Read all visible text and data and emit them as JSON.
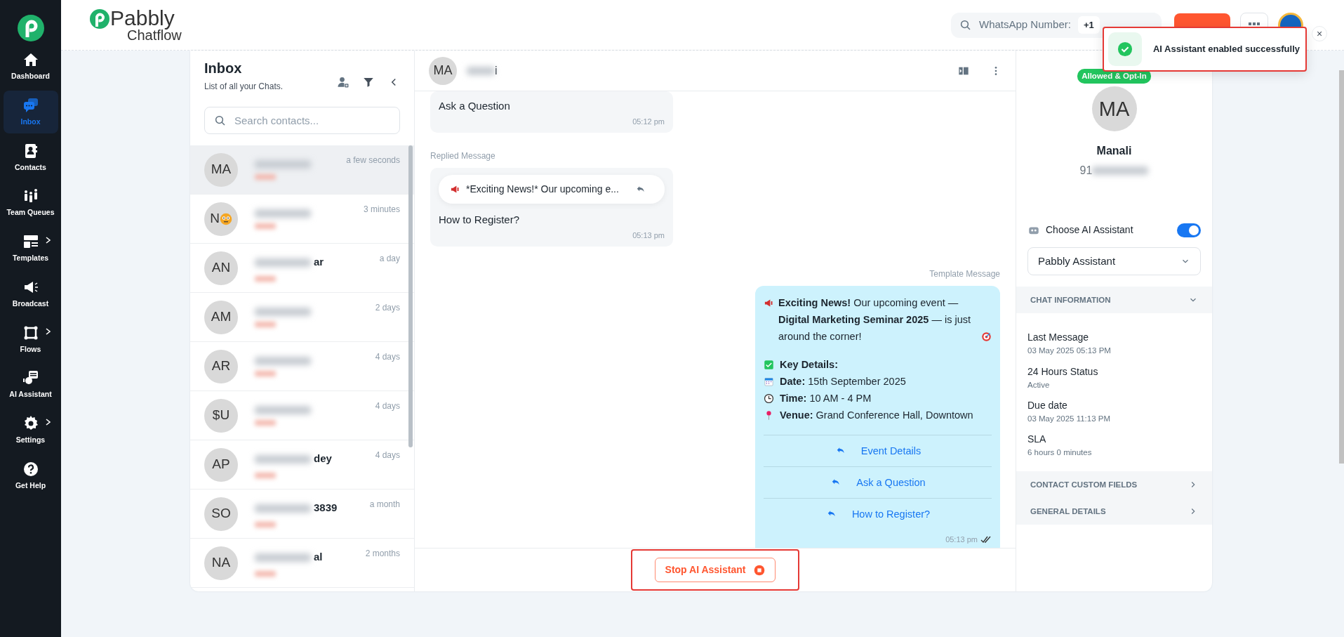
{
  "sidebar": {
    "items": [
      {
        "label": "Dashboard",
        "selected": false,
        "submenu": false
      },
      {
        "label": "Inbox",
        "selected": true,
        "submenu": false
      },
      {
        "label": "Contacts",
        "selected": false,
        "submenu": false
      },
      {
        "label": "Team Queues",
        "selected": false,
        "submenu": false
      },
      {
        "label": "Templates",
        "selected": false,
        "submenu": true
      },
      {
        "label": "Broadcast",
        "selected": false,
        "submenu": false
      },
      {
        "label": "Flows",
        "selected": false,
        "submenu": true
      },
      {
        "label": "AI Assistant",
        "selected": false,
        "submenu": false
      },
      {
        "label": "Settings",
        "selected": false,
        "submenu": true
      },
      {
        "label": "Get Help",
        "selected": false,
        "submenu": false
      }
    ]
  },
  "header": {
    "brand": [
      "Pabbly",
      "Chatflow"
    ],
    "search": {
      "label": "WhatsApp Number:",
      "value": "+1"
    }
  },
  "toast": {
    "message": "AI Assistant enabled successfully",
    "close": "×"
  },
  "inbox": {
    "title": "Inbox",
    "subtitle": "List of all your Chats.",
    "search": {
      "placeholder": "Search contacts..."
    },
    "contacts": [
      {
        "initials": "MA",
        "emoji": false,
        "time": "a few seconds",
        "selected": true
      },
      {
        "initials": "N",
        "emoji": true,
        "time": "3 minutes",
        "selected": false
      },
      {
        "initials": "AN",
        "emoji": false,
        "name_tail": "ar",
        "time": "a day",
        "selected": false
      },
      {
        "initials": "AM",
        "emoji": false,
        "time": "2 days",
        "selected": false
      },
      {
        "initials": "AR",
        "emoji": false,
        "time": "4 days",
        "selected": false
      },
      {
        "initials": "$U",
        "emoji": false,
        "time": "4 days",
        "selected": false
      },
      {
        "initials": "AP",
        "emoji": false,
        "name_tail": "dey",
        "time": "4 days",
        "selected": false
      },
      {
        "initials": "SO",
        "emoji": false,
        "name_tail": "3839",
        "time": "a month",
        "selected": false
      },
      {
        "initials": "NA",
        "emoji": false,
        "name_tail": "al",
        "time": "2 months",
        "selected": false
      }
    ]
  },
  "chat": {
    "initials": "MA",
    "name_tail": "i",
    "messages": [
      {
        "kind": "incoming",
        "text": "Ask a Question",
        "time": "05:12 pm"
      },
      {
        "kind": "reply",
        "label": "Replied Message",
        "quote": "*Exciting News!* Our upcoming e...",
        "text": "How to Register?",
        "time": "05:13 pm"
      },
      {
        "kind": "template",
        "label": "Template Message",
        "text": "**Exciting News!** Our upcoming event — **Digital Marketing Seminar 2025** — is just around the corner!",
        "details": [
          {
            "kind": "check",
            "label": "Key Details:"
          },
          {
            "kind": "calendar",
            "label": "Date:",
            "value": "15th September 2025"
          },
          {
            "kind": "clock",
            "label": "Time:",
            "value": "10 AM - 4 PM"
          },
          {
            "kind": "pin",
            "label": "Venue:",
            "value": "Grand Conference Hall, Downtown"
          }
        ],
        "buttons": [
          "Event Details",
          "Ask a Question",
          "How to Register?"
        ],
        "time": "05:13 pm",
        "read": true
      }
    ],
    "stop_button": "Stop AI Assistant"
  },
  "contact": {
    "badge": "Allowed & Opt-In",
    "initials": "MA",
    "name": "Manali",
    "phone": "91",
    "ai": {
      "label": "Choose AI Assistant",
      "on": true,
      "assistant": "Pabbly Assistant"
    },
    "sections": [
      {
        "title": "CHAT INFORMATION",
        "expanded": true,
        "fields": [
          {
            "label": "Last Message",
            "value": "03 May 2025 05:13 PM"
          },
          {
            "label": "24 Hours Status",
            "value": "Active"
          },
          {
            "label": "Due date",
            "value": "03 May 2025 11:13 PM"
          },
          {
            "label": "SLA",
            "value": "6 hours 0 minutes"
          }
        ]
      },
      {
        "title": "CONTACT CUSTOM FIELDS",
        "expanded": false
      },
      {
        "title": "GENERAL DETAILS",
        "expanded": false
      }
    ]
  }
}
